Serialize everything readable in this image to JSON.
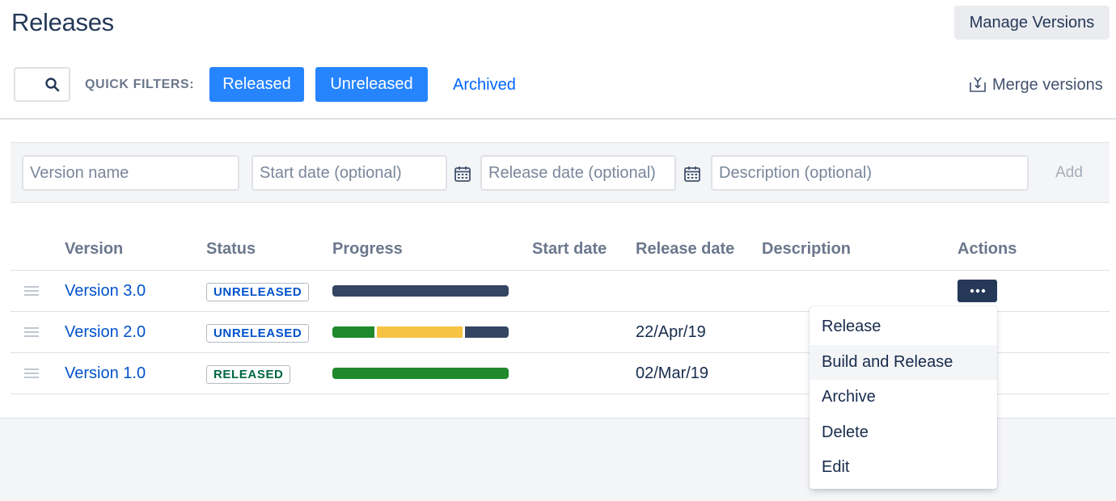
{
  "header": {
    "title": "Releases",
    "manage_versions": "Manage Versions"
  },
  "filters": {
    "search_icon": "search-icon",
    "quick_filters_label": "QUICK FILTERS:",
    "released": "Released",
    "unreleased": "Unreleased",
    "archived": "Archived",
    "merge_label": "Merge versions",
    "merge_icon": "merge-icon"
  },
  "add_form": {
    "version_placeholder": "Version name",
    "start_placeholder": "Start date (optional)",
    "release_placeholder": "Release date (optional)",
    "description_placeholder": "Description (optional)",
    "add_label": "Add",
    "calendar_icon": "calendar-icon"
  },
  "table": {
    "columns": [
      "Version",
      "Status",
      "Progress",
      "Start date",
      "Release date",
      "Description",
      "Actions"
    ],
    "rows": [
      {
        "version": "Version 3.0",
        "status": "UNRELEASED",
        "progress": [
          {
            "fraction": 1.0,
            "color": "#344563"
          }
        ],
        "start_date": "",
        "release_date": "",
        "description": ""
      },
      {
        "version": "Version 2.0",
        "status": "UNRELEASED",
        "progress": [
          {
            "fraction": 0.25,
            "color": "#1f8a2d"
          },
          {
            "fraction": 0.5,
            "color": "#f6c342"
          },
          {
            "fraction": 0.25,
            "color": "#344563"
          }
        ],
        "start_date": "",
        "release_date": "22/Apr/19",
        "description": ""
      },
      {
        "version": "Version 1.0",
        "status": "RELEASED",
        "progress": [
          {
            "fraction": 1.0,
            "color": "#1f8a2d"
          }
        ],
        "start_date": "",
        "release_date": "02/Mar/19",
        "description": ""
      }
    ]
  },
  "actions_menu": {
    "trigger_icon": "more-icon",
    "items": [
      "Release",
      "Build and Release",
      "Archive",
      "Delete",
      "Edit"
    ],
    "highlighted": "Build and Release"
  },
  "colors": {
    "primary": "#2684ff",
    "link": "#0052cc",
    "done": "#1f8a2d",
    "in_progress": "#f6c342",
    "todo": "#344563"
  }
}
